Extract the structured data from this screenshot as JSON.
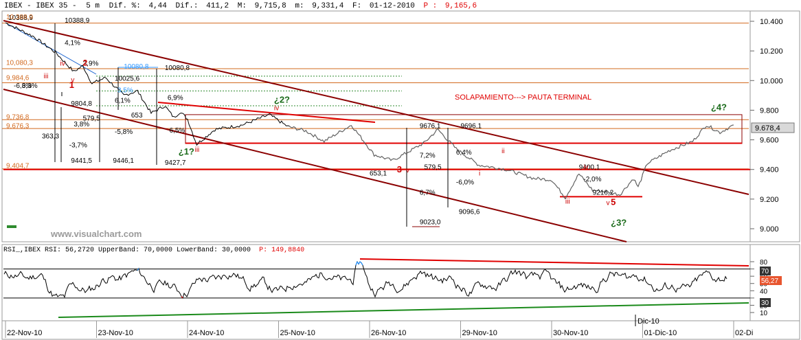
{
  "header": {
    "symbol": "IBEX - IBEX 35 -",
    "interval": "5 m",
    "dif_label": "Dif. %:",
    "dif_pct": "4,44",
    "dif_abs_label": "Dif.:",
    "dif_abs": "411,2",
    "m_label": "M:",
    "max": "9,715,8",
    "m2_label": "m:",
    "min": "9,331,4",
    "f_label": "F:",
    "date": "01-12-2010",
    "p_label": "P :",
    "price": "9,165,6"
  },
  "watermark": "www.visualchart.com",
  "annotation_title": "SOLAPAMIENTO---> PAUTA TERMINAL",
  "current_price_badge": "9.678,4",
  "colors": {
    "price": "#000000",
    "channel": "#8b0000",
    "fib_orange": "#d2691e",
    "fib_green_dotted": "#2e8b2e",
    "red_line": "#e00000",
    "wave_red": "#cc0000",
    "wave_green": "#1a6b1a",
    "rsi_line": "#000000",
    "rsi_up": "#1e90ff",
    "rsi_down": "#e00000",
    "rsi_badge": "#e8552f",
    "rsi_band_badge": "#333333"
  },
  "rsi_header": {
    "text": "RSI_,IBEX RSI: 56,2720 UpperBand: 70,0000 LowerBand: 30,0000",
    "p_label": "P: 149,8840"
  },
  "rsi_badges": {
    "value": "56,27",
    "upper": "70",
    "lower": "30"
  },
  "chart_data": [
    {
      "type": "line",
      "title": "IBEX - IBEX 35 - 5 m",
      "x_labels": [
        "22-Nov-10",
        "23-Nov-10",
        "24-Nov-10",
        "25-Nov-10",
        "26-Nov-10",
        "29-Nov-10",
        "30-Nov-10",
        "01-Dic-10",
        "02-Di"
      ],
      "x_marker_label": "Dic-10",
      "y_ticks": [
        "10.400",
        "10.200",
        "10.000",
        "9.800",
        "9.600",
        "9.400",
        "9.200",
        "9.000"
      ],
      "ylim": [
        8.89,
        10.45
      ],
      "key_points": [
        {
          "x": 0.0,
          "y": 10.39
        },
        {
          "x": 0.3,
          "y": 10.3
        },
        {
          "x": 0.55,
          "y": 10.19
        },
        {
          "x": 0.75,
          "y": 10.06
        },
        {
          "x": 0.85,
          "y": 10.1
        },
        {
          "x": 0.95,
          "y": 9.98
        },
        {
          "x": 1.1,
          "y": 10.02
        },
        {
          "x": 1.3,
          "y": 9.9
        },
        {
          "x": 1.45,
          "y": 9.93
        },
        {
          "x": 1.6,
          "y": 9.78
        },
        {
          "x": 1.75,
          "y": 9.83
        },
        {
          "x": 1.85,
          "y": 9.75
        },
        {
          "x": 1.92,
          "y": 9.79
        },
        {
          "x": 2.0,
          "y": 9.74
        },
        {
          "x": 2.1,
          "y": 9.57
        },
        {
          "x": 2.3,
          "y": 9.67
        },
        {
          "x": 2.6,
          "y": 9.7
        },
        {
          "x": 2.9,
          "y": 9.77
        },
        {
          "x": 3.1,
          "y": 9.69
        },
        {
          "x": 3.3,
          "y": 9.66
        },
        {
          "x": 3.5,
          "y": 9.59
        },
        {
          "x": 3.8,
          "y": 9.7
        },
        {
          "x": 4.05,
          "y": 9.5
        },
        {
          "x": 4.25,
          "y": 9.46
        },
        {
          "x": 4.4,
          "y": 9.51
        },
        {
          "x": 4.6,
          "y": 9.58
        },
        {
          "x": 4.75,
          "y": 9.67
        },
        {
          "x": 4.95,
          "y": 9.54
        },
        {
          "x": 5.2,
          "y": 9.43
        },
        {
          "x": 5.5,
          "y": 9.4
        },
        {
          "x": 5.8,
          "y": 9.34
        },
        {
          "x": 6.0,
          "y": 9.33
        },
        {
          "x": 6.15,
          "y": 9.21
        },
        {
          "x": 6.3,
          "y": 9.37
        },
        {
          "x": 6.45,
          "y": 9.26
        },
        {
          "x": 6.6,
          "y": 9.25
        },
        {
          "x": 6.75,
          "y": 9.23
        },
        {
          "x": 6.9,
          "y": 9.34
        },
        {
          "x": 6.95,
          "y": 9.28
        },
        {
          "x": 7.05,
          "y": 9.44
        },
        {
          "x": 7.3,
          "y": 9.53
        },
        {
          "x": 7.55,
          "y": 9.59
        },
        {
          "x": 7.7,
          "y": 9.7
        },
        {
          "x": 7.85,
          "y": 9.65
        },
        {
          "x": 8.0,
          "y": 9.7
        }
      ],
      "horizontal_levels_orange": [
        10.388,
        10.08,
        9.985,
        9.736,
        9.676,
        9.404
      ],
      "horizontal_levels_green_dotted": [
        10.03,
        9.93,
        9.83
      ],
      "red_horizontal_lines": [
        9.577,
        9.216
      ],
      "box_lines": [
        9.77,
        9.575
      ],
      "price_labels": [
        {
          "text": "10388,9",
          "x": 0.03,
          "y": 10.41,
          "color": "#000000"
        },
        {
          "text": "10388,9",
          "x": 0.65,
          "y": 10.39,
          "color": "#000000"
        },
        {
          "text": "4,1%",
          "x": 0.65,
          "y": 10.24,
          "color": "#000000"
        },
        {
          "text": "3,9%",
          "x": 0.85,
          "y": 10.1,
          "color": "#000000"
        },
        {
          "text": "10080,8",
          "x": 1.3,
          "y": 10.08,
          "color": "#3399ff"
        },
        {
          "text": "10080,8",
          "x": 1.75,
          "y": 10.07,
          "color": "#000000"
        },
        {
          "text": "10025,6",
          "x": 1.2,
          "y": 10.0,
          "color": "#000000"
        },
        {
          "text": "3,5%",
          "x": 1.23,
          "y": 9.92,
          "color": "#3399ff"
        },
        {
          "text": "6,1%",
          "x": 1.2,
          "y": 9.85,
          "color": "#000000"
        },
        {
          "text": "6,9%",
          "x": 1.78,
          "y": 9.87,
          "color": "#000000"
        },
        {
          "text": "6,3%",
          "x": 0.18,
          "y": 9.95,
          "color": "#000000"
        },
        {
          "text": "9804,8",
          "x": 0.72,
          "y": 9.83,
          "color": "#000000"
        },
        {
          "text": "579,5",
          "x": 0.85,
          "y": 9.73,
          "color": "#000000"
        },
        {
          "text": "3,8%",
          "x": 0.75,
          "y": 9.69,
          "color": "#000000"
        },
        {
          "text": "363,3",
          "x": 0.4,
          "y": 9.61,
          "color": "#000000"
        },
        {
          "text": "-5,8%",
          "x": 1.2,
          "y": 9.64,
          "color": "#000000"
        },
        {
          "text": "6,5%",
          "x": 1.8,
          "y": 9.65,
          "color": "#000000"
        },
        {
          "text": "-3,7%",
          "x": 0.7,
          "y": 9.55,
          "color": "#000000"
        },
        {
          "text": "9441,5",
          "x": 0.72,
          "y": 9.445,
          "color": "#000000"
        },
        {
          "text": "9446,1",
          "x": 1.18,
          "y": 9.445,
          "color": "#000000"
        },
        {
          "text": "9427,7",
          "x": 1.75,
          "y": 9.43,
          "color": "#000000"
        },
        {
          "text": "653",
          "x": 1.38,
          "y": 9.75,
          "color": "#000000"
        },
        {
          "text": "9676,1",
          "x": 4.55,
          "y": 9.68,
          "color": "#000000"
        },
        {
          "text": "9696,1",
          "x": 5.0,
          "y": 9.68,
          "color": "#000000"
        },
        {
          "text": "6,4%",
          "x": 4.95,
          "y": 9.5,
          "color": "#000000"
        },
        {
          "text": "7,2%",
          "x": 4.55,
          "y": 9.48,
          "color": "#000000"
        },
        {
          "text": "579,5",
          "x": 4.6,
          "y": 9.4,
          "color": "#000000"
        },
        {
          "text": "653,1",
          "x": 4.0,
          "y": 9.36,
          "color": "#000000"
        },
        {
          "text": "-6,0%",
          "x": 4.95,
          "y": 9.3,
          "color": "#000000"
        },
        {
          "text": "6,7%",
          "x": 4.55,
          "y": 9.23,
          "color": "#000000"
        },
        {
          "text": "9096,6",
          "x": 4.98,
          "y": 9.1,
          "color": "#000000"
        },
        {
          "text": "9023,0",
          "x": 4.55,
          "y": 9.03,
          "color": "#000000"
        },
        {
          "text": "9400,1",
          "x": 6.3,
          "y": 9.4,
          "color": "#000000"
        },
        {
          "text": "-2,0%",
          "x": 6.35,
          "y": 9.32,
          "color": "#000000"
        },
        {
          "text": "9216,2",
          "x": 6.45,
          "y": 9.23,
          "color": "#000000"
        }
      ],
      "orange_axis_labels": [
        {
          "text": "10,388,9",
          "y": 10.41
        },
        {
          "text": "10,080,3",
          "y": 10.1
        },
        {
          "text": "9,984,6",
          "y": 10.0
        },
        {
          "text": "9,736,8",
          "y": 9.735
        },
        {
          "text": "9,676,3",
          "y": 9.675
        },
        {
          "text": "9,404,7",
          "y": 9.405
        }
      ],
      "red_axis_labels": [
        {
          "text": "-6,3%",
          "y": 9.95
        }
      ],
      "wave_labels": [
        {
          "text": "1",
          "x": 0.7,
          "y": 9.95,
          "color": "#cc0000",
          "size": 13
        },
        {
          "text": "2",
          "x": 0.85,
          "y": 10.1,
          "color": "#cc0000",
          "size": 12
        },
        {
          "text": "¿1?",
          "x": 1.9,
          "y": 9.5,
          "color": "#1a6b1a",
          "size": 13
        },
        {
          "text": "¿2?",
          "x": 2.95,
          "y": 9.85,
          "color": "#1a6b1a",
          "size": 13
        },
        {
          "text": "3",
          "x": 4.3,
          "y": 9.38,
          "color": "#cc0000",
          "size": 13
        },
        {
          "text": "5",
          "x": 6.65,
          "y": 9.16,
          "color": "#cc0000",
          "size": 13
        },
        {
          "text": "¿3?",
          "x": 6.65,
          "y": 9.02,
          "color": "#1a6b1a",
          "size": 13
        },
        {
          "text": "¿4?",
          "x": 7.75,
          "y": 9.8,
          "color": "#1a6b1a",
          "size": 13
        }
      ],
      "small_labels": [
        {
          "text": "v",
          "x": 0.72,
          "y": 9.99,
          "color": "#cc0000"
        },
        {
          "text": "iii",
          "x": 0.42,
          "y": 10.015,
          "color": "#cc0000"
        },
        {
          "text": "iv",
          "x": 0.6,
          "y": 10.1,
          "color": "#cc0000"
        },
        {
          "text": "iii",
          "x": 2.08,
          "y": 9.52,
          "color": "#cc0000"
        },
        {
          "text": "iv",
          "x": 2.95,
          "y": 9.8,
          "color": "#cc0000"
        },
        {
          "text": "v",
          "x": 4.4,
          "y": 9.38,
          "color": "#cc0000"
        },
        {
          "text": "i",
          "x": 5.2,
          "y": 9.36,
          "color": "#cc0000"
        },
        {
          "text": "ii",
          "x": 5.45,
          "y": 9.51,
          "color": "#cc0000"
        },
        {
          "text": "iii",
          "x": 6.15,
          "y": 9.17,
          "color": "#cc0000"
        },
        {
          "text": "iv",
          "x": 6.35,
          "y": 9.4,
          "color": "#cc0000"
        },
        {
          "text": "v",
          "x": 6.6,
          "y": 9.16,
          "color": "#cc0000"
        }
      ]
    },
    {
      "type": "line",
      "title": "RSI_,IBEX RSI: 56,2720 UpperBand: 70,0000 LowerBand: 30,0000",
      "name": "RSI",
      "y_ticks": [
        "80",
        "70",
        "60",
        "50",
        "40",
        "30",
        "20",
        "10"
      ],
      "ylim": [
        8,
        88
      ],
      "upper_band": 70,
      "lower_band": 30,
      "current_value": 56.272
    }
  ]
}
